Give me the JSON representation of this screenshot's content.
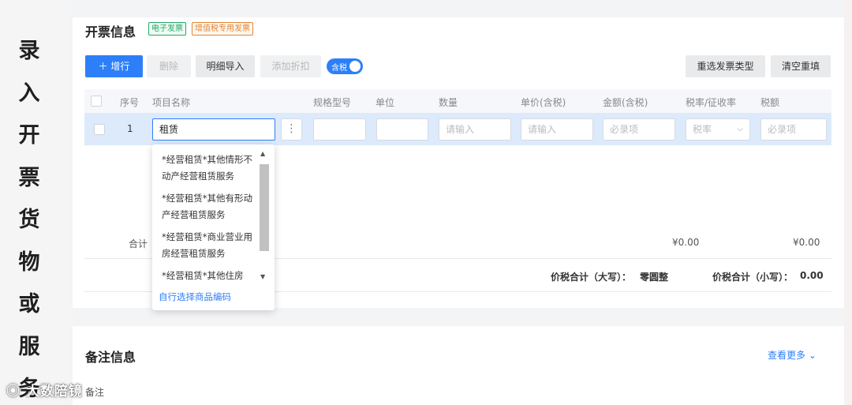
{
  "side_text": [
    "录",
    "入",
    "开",
    "票",
    "货",
    "物",
    "或",
    "服",
    "务"
  ],
  "watermark": "大数陪镜",
  "invoice": {
    "title": "开票信息",
    "tags": [
      "电子发票",
      "增值税专用发票"
    ]
  },
  "toolbar": {
    "add_row": "增行",
    "delete": "删除",
    "import_detail": "明细导入",
    "add_discount": "添加折扣",
    "tax_toggle_label": "含税",
    "tax_toggle_on": true,
    "reselect_type": "重选发票类型",
    "clear_refill": "清空重填"
  },
  "table": {
    "headers": [
      "序号",
      "项目名称",
      "规格型号",
      "单位",
      "数量",
      "单价(含税)",
      "金额(含税)",
      "税率/征收率",
      "税额"
    ],
    "row": {
      "index": "1",
      "item_name": "租赁",
      "quantity_placeholder": "请输入",
      "price_placeholder": "请输入",
      "amount_placeholder": "必录项",
      "tax_rate_placeholder": "税率",
      "tax_amount_placeholder": "必录项"
    }
  },
  "dropdown": {
    "items": [
      "*经营租赁*其他情形不动产经营租赁服务",
      "*经营租赁*其他有形动产经营租赁服务",
      "*经营租赁*商业营业用房经营租赁服务",
      "*经营租赁*其他住房"
    ],
    "footer": "自行选择商品编码"
  },
  "summary": {
    "label": "合计",
    "amount": "¥0.00",
    "tax": "¥0.00",
    "total_upper_label": "价税合计（大写）：",
    "total_upper_value": "零圆整",
    "total_lower_label": "价税合计（小写）：",
    "total_lower_value": "0.00"
  },
  "notes": {
    "title": "备注信息",
    "view_more": "查看更多",
    "field_label": "备注"
  },
  "colors": {
    "accent": "#2d7ff9",
    "row_highlight": "#dceafb"
  }
}
